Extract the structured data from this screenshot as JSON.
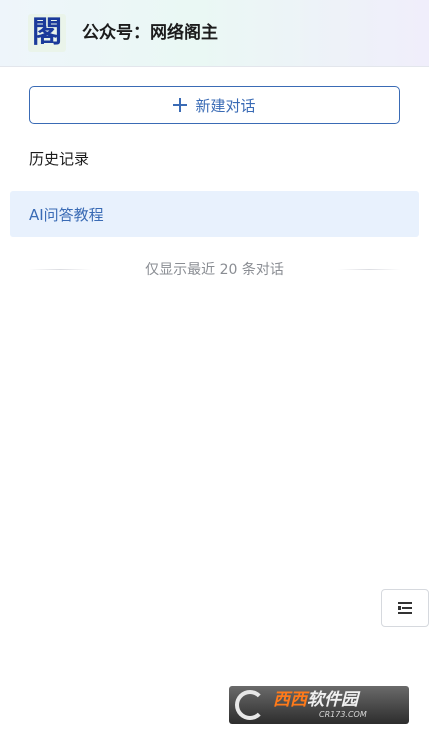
{
  "header": {
    "logo_glyph": "閣",
    "title": "公众号：网络阁主"
  },
  "new_chat": {
    "label": "新建对话",
    "icon": "plus-icon"
  },
  "history": {
    "title": "历史记录",
    "items": [
      {
        "label": "AI问答教程",
        "active": true
      }
    ],
    "limit_notice": "仅显示最近 20 条对话"
  },
  "floating_menu": {
    "icon": "menu-list-icon"
  },
  "watermark": {
    "main_orange": "西西",
    "main_white": "软件园",
    "sub": "CR173.COM"
  },
  "colors": {
    "accent": "#3a6bb5",
    "active_bg": "#e8f1fd",
    "muted_text": "#8a8d93"
  }
}
